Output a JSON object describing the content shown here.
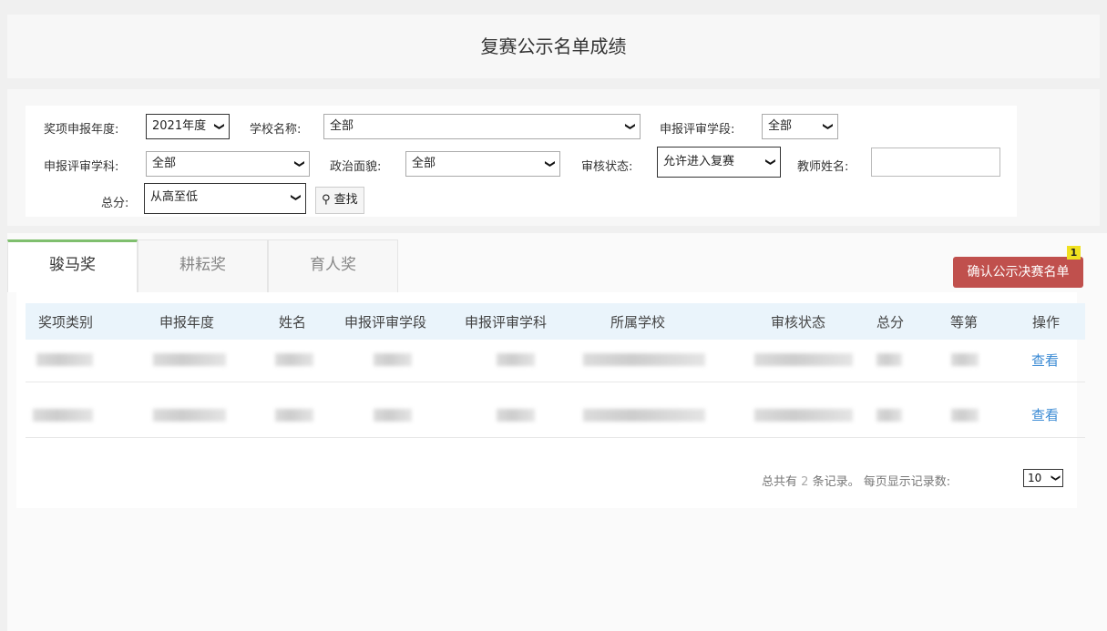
{
  "page": {
    "title": "复赛公示名单成绩"
  },
  "filters": {
    "award_year_label": "奖项申报年度:",
    "award_year_value": "2021年度",
    "school_label": "学校名称:",
    "school_value": "全部",
    "stage_label": "申报评审学段:",
    "stage_value": "全部",
    "subject_label": "申报评审学科:",
    "subject_value": "全部",
    "politics_label": "政治面貌:",
    "politics_value": "全部",
    "audit_label": "审核状态:",
    "audit_value": "允许进入复赛",
    "teacher_label": "教师姓名:",
    "teacher_value": "",
    "total_label": "总分:",
    "total_value": "从高至低",
    "search_label": "查找"
  },
  "tabs": [
    "骏马奖",
    "耕耘奖",
    "育人奖"
  ],
  "confirm_button": {
    "label": "确认公示决赛名单",
    "badge": "1"
  },
  "table": {
    "headers": [
      "奖项类别",
      "申报年度",
      "姓名",
      "申报评审学段",
      "申报评审学科",
      "所属学校",
      "审核状态",
      "总分",
      "等第",
      "操作"
    ],
    "rows": [
      {
        "action": "查看"
      },
      {
        "action": "查看"
      }
    ]
  },
  "pager": {
    "prefix": "总共有",
    "count": "2",
    "suffix": "条记录。 每页显示记录数:",
    "page_size": "10"
  },
  "colors": {
    "accent_tab": "#7fbf6e",
    "confirm_button": "#c0504d",
    "link": "#3a8ad4",
    "header_bg": "#eaf4fb"
  }
}
